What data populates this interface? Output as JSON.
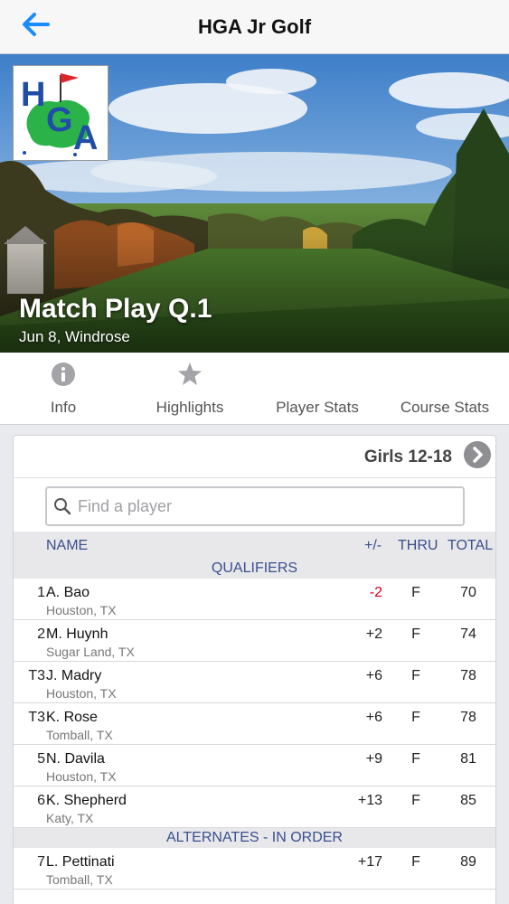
{
  "nav": {
    "title": "HGA Jr Golf"
  },
  "event": {
    "title": "Match Play Q.1",
    "subtitle": "Jun 8, Windrose"
  },
  "tabs": [
    {
      "label": "Info",
      "icon": "info-icon"
    },
    {
      "label": "Highlights",
      "icon": "star-icon"
    },
    {
      "label": "Player Stats",
      "icon": ""
    },
    {
      "label": "Course Stats",
      "icon": ""
    }
  ],
  "leaderboard": {
    "division": "Girls 12-18",
    "search_placeholder": "Find a player",
    "columns": {
      "name": "NAME",
      "plus_minus": "+/-",
      "thru": "THRU",
      "total": "TOTAL"
    },
    "sections": [
      {
        "title": "QUALIFIERS",
        "players": [
          {
            "pos": "1",
            "name": "A. Bao",
            "location": "Houston, TX",
            "plus_minus": "-2",
            "thru": "F",
            "total": "70"
          },
          {
            "pos": "2",
            "name": "M. Huynh",
            "location": "Sugar Land, TX",
            "plus_minus": "+2",
            "thru": "F",
            "total": "74"
          },
          {
            "pos": "T3",
            "name": "J. Madry",
            "location": "Houston, TX",
            "plus_minus": "+6",
            "thru": "F",
            "total": "78"
          },
          {
            "pos": "T3",
            "name": "K. Rose",
            "location": "Tomball, TX",
            "plus_minus": "+6",
            "thru": "F",
            "total": "78"
          },
          {
            "pos": "5",
            "name": "N. Davila",
            "location": "Houston, TX",
            "plus_minus": "+9",
            "thru": "F",
            "total": "81"
          },
          {
            "pos": "6",
            "name": "K. Shepherd",
            "location": "Katy, TX",
            "plus_minus": "+13",
            "thru": "F",
            "total": "85"
          }
        ]
      },
      {
        "title": "ALTERNATES - IN ORDER",
        "players": [
          {
            "pos": "7",
            "name": "L. Pettinati",
            "location": "Tomball, TX",
            "plus_minus": "+17",
            "thru": "F",
            "total": "89"
          }
        ]
      }
    ]
  },
  "colors": {
    "accent": "#1a8cff",
    "header_text": "#3a4f8c",
    "negative": "#d0021b"
  }
}
